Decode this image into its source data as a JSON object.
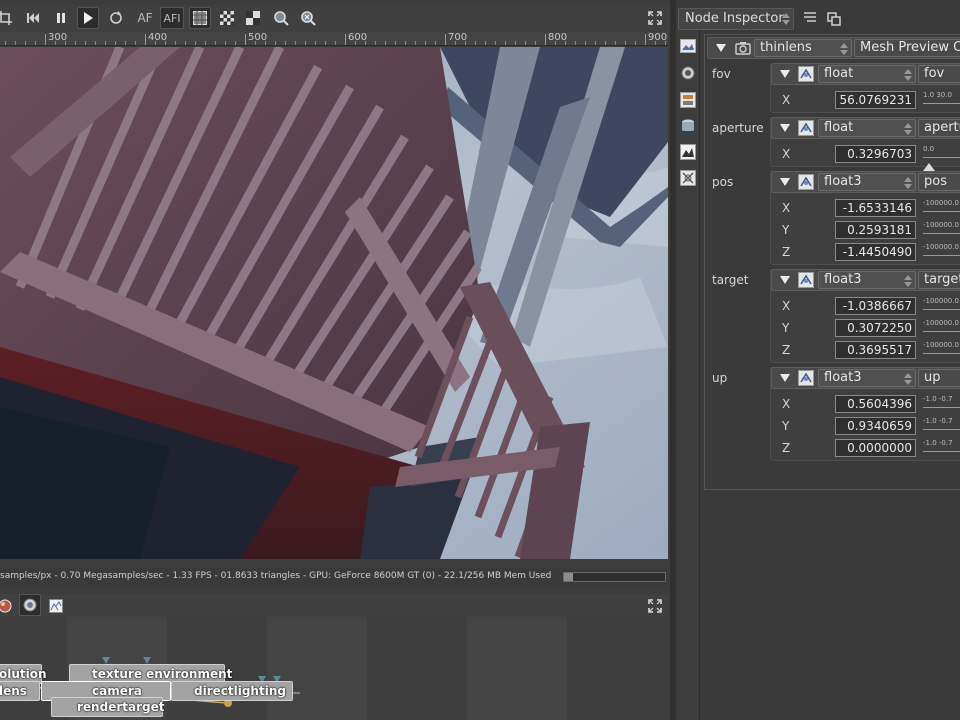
{
  "viewer": {
    "toolbar": {
      "af_label": "AF",
      "afi_label": "AFI"
    },
    "ruler": {
      "labels": [
        "300",
        "400",
        "500",
        "600",
        "700",
        "800",
        "900"
      ]
    },
    "status": {
      "text": "samples/px - 0.70 Megasamples/sec - 1.33 FPS - 01.8633 triangles - GPU: GeForce 8600M GT (0) - 22.1/256 MB Mem Used",
      "memory_fraction": 0.09
    }
  },
  "graph": {
    "nodes": {
      "resolution": "olution",
      "texture_environment": "texture environment",
      "thinlens": "lens",
      "camera": "camera",
      "directlighting": "directlighting",
      "rendertarget": "rendertarget"
    }
  },
  "inspector": {
    "title": "Node Inspector",
    "node_type": "thinlens",
    "node_name": "Mesh Preview Camera",
    "pins": [
      {
        "label": "fov",
        "type": "float",
        "name": "fov",
        "axes": [
          {
            "axis": "X",
            "value": "56.0769231",
            "range": "1.0  30.0"
          }
        ]
      },
      {
        "label": "aperture",
        "type": "float",
        "name": "aperture",
        "axes": [
          {
            "axis": "X",
            "value": "0.3296703",
            "range": "0.0"
          }
        ]
      },
      {
        "label": "pos",
        "type": "float3",
        "name": "pos",
        "axes": [
          {
            "axis": "X",
            "value": "-1.6533146",
            "range": "-100000.0"
          },
          {
            "axis": "Y",
            "value": "0.2593181",
            "range": "-100000.0"
          },
          {
            "axis": "Z",
            "value": "-1.4450490",
            "range": "-100000.0"
          }
        ]
      },
      {
        "label": "target",
        "type": "float3",
        "name": "target",
        "axes": [
          {
            "axis": "X",
            "value": "-1.0386667",
            "range": "-100000.0"
          },
          {
            "axis": "Y",
            "value": "0.3072250",
            "range": "-100000.0"
          },
          {
            "axis": "Z",
            "value": "0.3695517",
            "range": "-100000.0"
          }
        ]
      },
      {
        "label": "up",
        "type": "float3",
        "name": "up",
        "axes": [
          {
            "axis": "X",
            "value": "0.5604396",
            "range": "-1.0  -0.7"
          },
          {
            "axis": "Y",
            "value": "0.9340659",
            "range": "-1.0  -0.7"
          },
          {
            "axis": "Z",
            "value": "0.0000000",
            "range": "-1.0  -0.7"
          }
        ]
      }
    ]
  },
  "icons": {
    "toolbar": [
      "crop-icon",
      "skip-back-icon",
      "pause-icon",
      "play-icon",
      "refresh-icon",
      "af-toggle",
      "afi-toggle",
      "alpha-grid-icon",
      "checker-icon",
      "half-checker-icon",
      "zoom-fit-icon",
      "zoom-reset-icon",
      "maximize-icon"
    ],
    "colors": {
      "panel": "#3a3a3a",
      "field_bg": "#2f2f2f",
      "node_bg": "#a3a3a3",
      "sky": "#aab6c6",
      "wood": "#5a3a44"
    }
  }
}
